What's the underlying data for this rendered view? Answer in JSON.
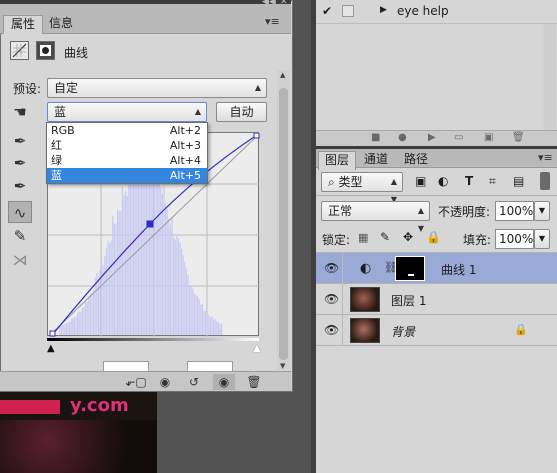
{
  "properties": {
    "tabs": [
      "属性",
      "信息"
    ],
    "title": "曲线",
    "preset_label": "预设:",
    "preset_value": "自定",
    "channel_value": "蓝",
    "auto_button": "自动",
    "channel_options": [
      {
        "label": "RGB",
        "shortcut": "Alt+2"
      },
      {
        "label": "红",
        "shortcut": "Alt+3"
      },
      {
        "label": "绿",
        "shortcut": "Alt+4"
      },
      {
        "label": "蓝",
        "shortcut": "Alt+5"
      }
    ],
    "highlighted_option": 3,
    "accent_color": "#3385dd",
    "curve_color": "#2b2bc8",
    "histogram_color": "#c9c9f2"
  },
  "actions": {
    "item_label": "eye help"
  },
  "layers": {
    "tabs": [
      "图层",
      "通道",
      "路径"
    ],
    "filter_label": "类型",
    "blend_mode": "正常",
    "opacity_label": "不透明度:",
    "opacity_value": "100%",
    "lock_label": "锁定:",
    "fill_label": "填充:",
    "fill_value": "100%",
    "rows": [
      {
        "name": "曲线 1",
        "selected": true
      },
      {
        "name": "图层 1",
        "selected": false
      },
      {
        "name": "背景",
        "selected": false
      }
    ],
    "selection_color": "#9aaad7"
  },
  "canvas": {
    "watermark_text": "y.com"
  }
}
